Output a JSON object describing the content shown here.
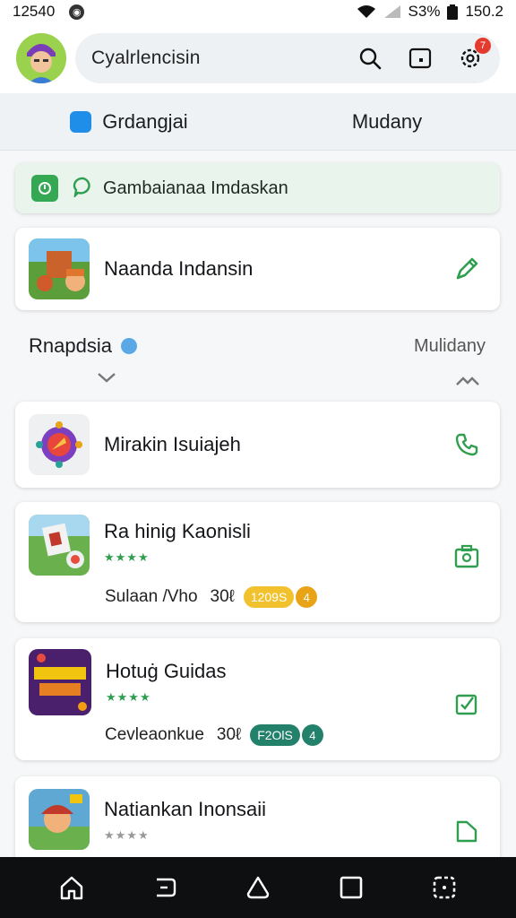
{
  "status_bar": {
    "time": "12540",
    "battery": "S3%",
    "clock_right": "150.2"
  },
  "header": {
    "title": "Cyalrlencisin",
    "notification_count": "7"
  },
  "tabs": [
    {
      "label": "Grdangjai"
    },
    {
      "label": "Mudany"
    }
  ],
  "banner": {
    "text": "Gambaianaa Imdaskan"
  },
  "featured": {
    "title": "Naanda Indansin"
  },
  "section": {
    "title": "Rnapdsia",
    "right_label": "Mulidany"
  },
  "items": [
    {
      "title": "Mirakin Isuiajeh"
    },
    {
      "title": "Ra hinig Kaonisli",
      "stars": "★★★★",
      "meta": "Sulaan /Vho",
      "percent": "30ℓ",
      "pill": "1209S",
      "pill_num": "4",
      "pill_color": "#f2c12e",
      "circle_color": "#e8a317"
    },
    {
      "title": "Hotuġ Guidas",
      "stars": "★★★★",
      "meta": "Cevleaonkue",
      "percent": "30ℓ",
      "pill": "F2OlS",
      "pill_num": "4",
      "pill_color": "#23806a",
      "circle_color": "#23806a"
    },
    {
      "title": "Natiankan Inonsaii",
      "stars": "★★★★"
    }
  ],
  "colors": {
    "accent_green": "#2f9e4f",
    "accent_blue": "#1e8ee8"
  }
}
